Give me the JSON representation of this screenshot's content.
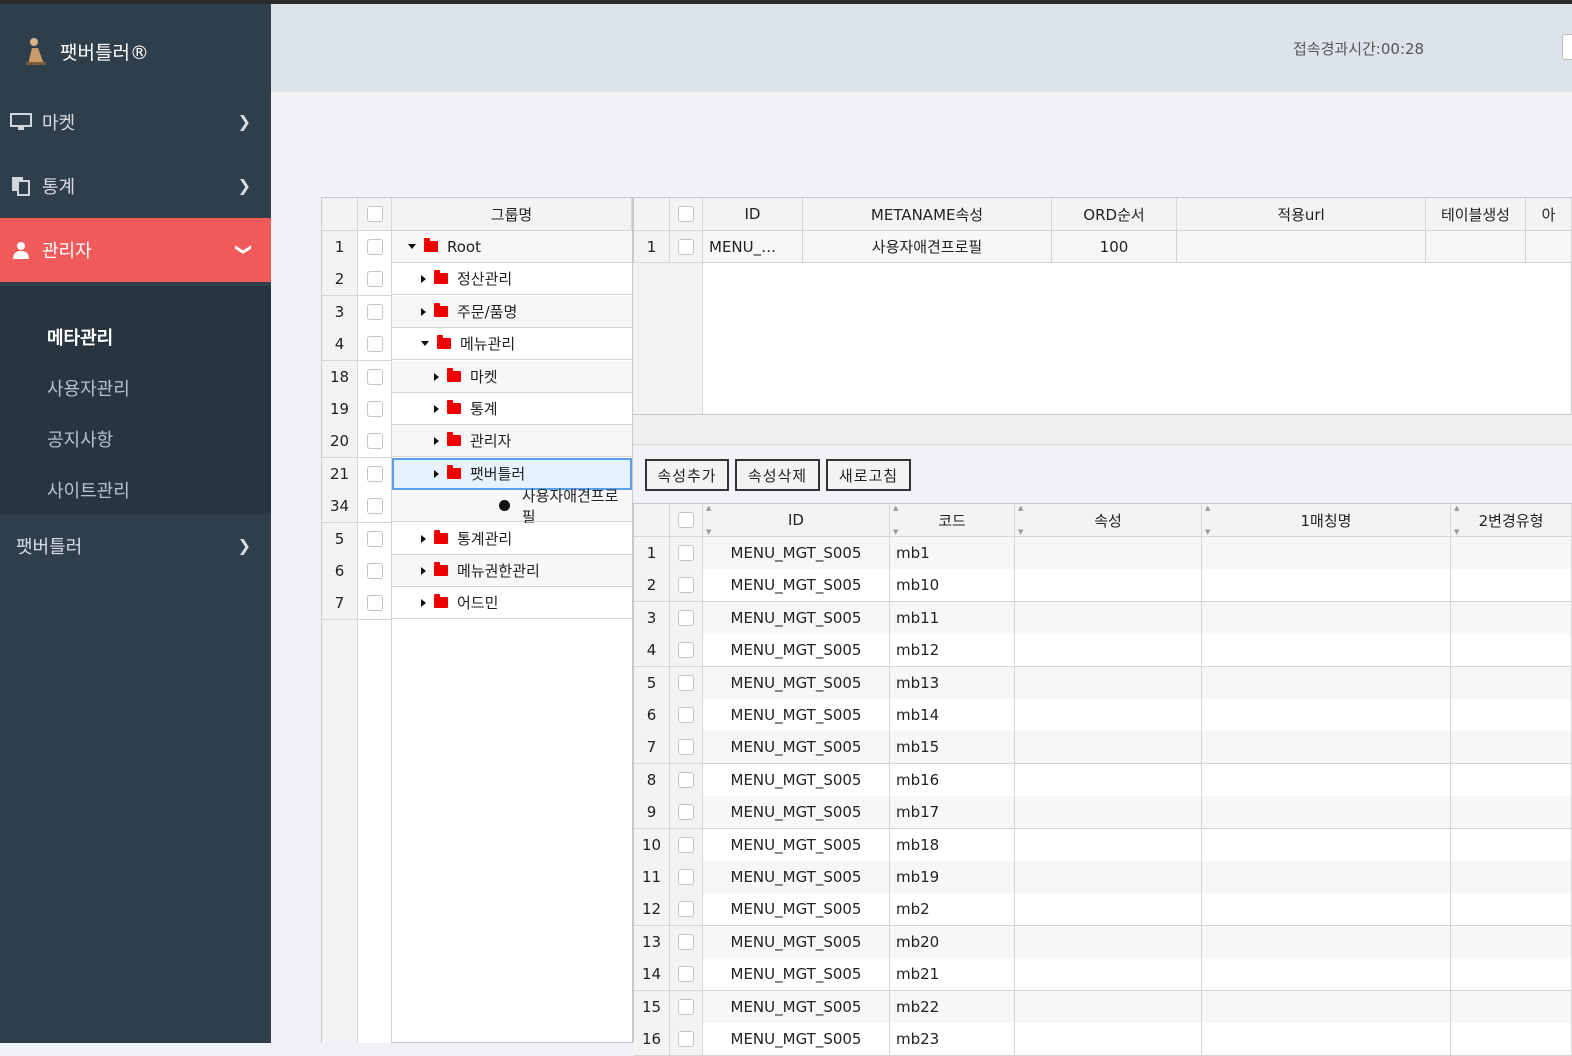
{
  "app": {
    "brand": "팻버틀러®"
  },
  "nav": [
    {
      "label": "마켓",
      "icon": "monitor-icon"
    },
    {
      "label": "통계",
      "icon": "copy-icon"
    },
    {
      "label": "관리자",
      "icon": "user-icon"
    },
    {
      "label": "팻버틀러"
    }
  ],
  "submenu": [
    "메타관리",
    "사용자관리",
    "공지사항",
    "사이트관리"
  ],
  "header": {
    "session": "접속경과시간:00:28"
  },
  "tree": {
    "header": "그룹명",
    "rows": [
      {
        "num": "1",
        "label": "Root"
      },
      {
        "num": "2",
        "label": "정산관리"
      },
      {
        "num": "3",
        "label": "주문/품명"
      },
      {
        "num": "4",
        "label": "메뉴관리"
      },
      {
        "num": "18",
        "label": "마켓"
      },
      {
        "num": "19",
        "label": "통계"
      },
      {
        "num": "20",
        "label": "관리자"
      },
      {
        "num": "21",
        "label": "팻버틀러"
      },
      {
        "num": "34",
        "label": "사용자애견프로필"
      },
      {
        "num": "5",
        "label": "통계관리"
      },
      {
        "num": "6",
        "label": "메뉴권한관리"
      },
      {
        "num": "7",
        "label": "어드민"
      }
    ]
  },
  "meta_grid": {
    "columns": [
      "ID",
      "METANAME속성",
      "ORD순서",
      "적용url",
      "테이블생성",
      "아"
    ],
    "rows": [
      {
        "num": "1",
        "id": "MENU_…",
        "name": "사용자애견프로필",
        "ord": "100",
        "url": "",
        "table": ""
      }
    ]
  },
  "buttons": {
    "add": "속성추가",
    "delete": "속성삭제",
    "refresh": "새로고침"
  },
  "attr_grid": {
    "columns": [
      "ID",
      "코드",
      "속성",
      "1매칭명",
      "2변경유형"
    ],
    "rows": [
      {
        "num": "1",
        "id": "MENU_MGT_S005",
        "code": "mb1"
      },
      {
        "num": "2",
        "id": "MENU_MGT_S005",
        "code": "mb10"
      },
      {
        "num": "3",
        "id": "MENU_MGT_S005",
        "code": "mb11"
      },
      {
        "num": "4",
        "id": "MENU_MGT_S005",
        "code": "mb12"
      },
      {
        "num": "5",
        "id": "MENU_MGT_S005",
        "code": "mb13"
      },
      {
        "num": "6",
        "id": "MENU_MGT_S005",
        "code": "mb14"
      },
      {
        "num": "7",
        "id": "MENU_MGT_S005",
        "code": "mb15"
      },
      {
        "num": "8",
        "id": "MENU_MGT_S005",
        "code": "mb16"
      },
      {
        "num": "9",
        "id": "MENU_MGT_S005",
        "code": "mb17"
      },
      {
        "num": "10",
        "id": "MENU_MGT_S005",
        "code": "mb18"
      },
      {
        "num": "11",
        "id": "MENU_MGT_S005",
        "code": "mb19"
      },
      {
        "num": "12",
        "id": "MENU_MGT_S005",
        "code": "mb2"
      },
      {
        "num": "13",
        "id": "MENU_MGT_S005",
        "code": "mb20"
      },
      {
        "num": "14",
        "id": "MENU_MGT_S005",
        "code": "mb21"
      },
      {
        "num": "15",
        "id": "MENU_MGT_S005",
        "code": "mb22"
      },
      {
        "num": "16",
        "id": "MENU_MGT_S005",
        "code": "mb23"
      }
    ]
  }
}
